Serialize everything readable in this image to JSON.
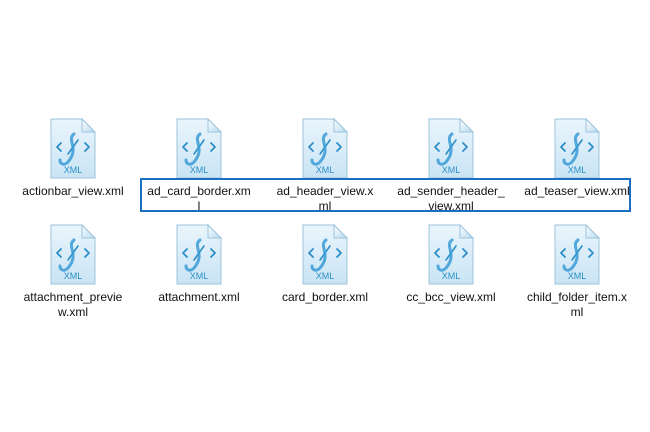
{
  "files": [
    {
      "label": "actionbar_view.xml",
      "icon": "xml-file-icon",
      "icon_text": "XML"
    },
    {
      "label": "ad_card_border.xm\nl",
      "icon": "xml-file-icon",
      "icon_text": "XML"
    },
    {
      "label": "ad_header_view.x\nml",
      "icon": "xml-file-icon",
      "icon_text": "XML"
    },
    {
      "label": "ad_sender_header_\nview.xml",
      "icon": "xml-file-icon",
      "icon_text": "XML"
    },
    {
      "label": "ad_teaser_view.xml",
      "icon": "xml-file-icon",
      "icon_text": "XML"
    },
    {
      "label": "attachment_previe\nw.xml",
      "icon": "xml-file-icon",
      "icon_text": "XML"
    },
    {
      "label": "attachment.xml",
      "icon": "xml-file-icon",
      "icon_text": "XML"
    },
    {
      "label": "card_border.xml",
      "icon": "xml-file-icon",
      "icon_text": "XML"
    },
    {
      "label": "cc_bcc_view.xml",
      "icon": "xml-file-icon",
      "icon_text": "XML"
    },
    {
      "label": "child_folder_item.x\nml",
      "icon": "xml-file-icon",
      "icon_text": "XML"
    }
  ],
  "colors": {
    "selection_border": "#1a6fc4",
    "icon_accent": "#2c8fc9"
  }
}
